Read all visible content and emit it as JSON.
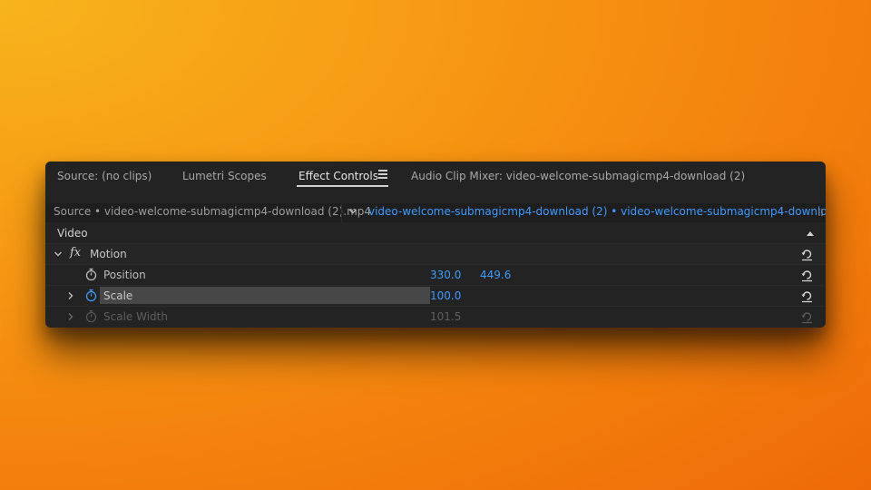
{
  "tabs": [
    {
      "label": "Source: (no clips)",
      "active": false
    },
    {
      "label": "Lumetri Scopes",
      "active": false
    },
    {
      "label": "Effect Controls",
      "active": true
    },
    {
      "label": "Audio Clip Mixer: video-welcome-submagicmp4-download (2)",
      "active": false
    }
  ],
  "source_bar": {
    "source": "Source • video-welcome-submagicmp4-download (2).mp4",
    "sequence": "video-welcome-submagicmp4-download (2) • video-welcome-submagicmp4-download ..."
  },
  "section": {
    "label": "Video"
  },
  "motion": {
    "label": "Motion",
    "fx": "fx"
  },
  "properties": {
    "position": {
      "label": "Position",
      "x": "330.0",
      "y": "449.6"
    },
    "scale": {
      "label": "Scale",
      "value": "100.0"
    },
    "scale_width": {
      "label": "Scale Width",
      "value": "101.5"
    }
  },
  "colors": {
    "accent": "#3a9bff",
    "panel": "#232323",
    "background": "#f79a14"
  },
  "icons": [
    "hamburger-menu-icon",
    "chevron-down-icon",
    "grip-icon",
    "triangle-up-icon",
    "chevron-right-icon",
    "stopwatch-icon",
    "reset-icon"
  ]
}
